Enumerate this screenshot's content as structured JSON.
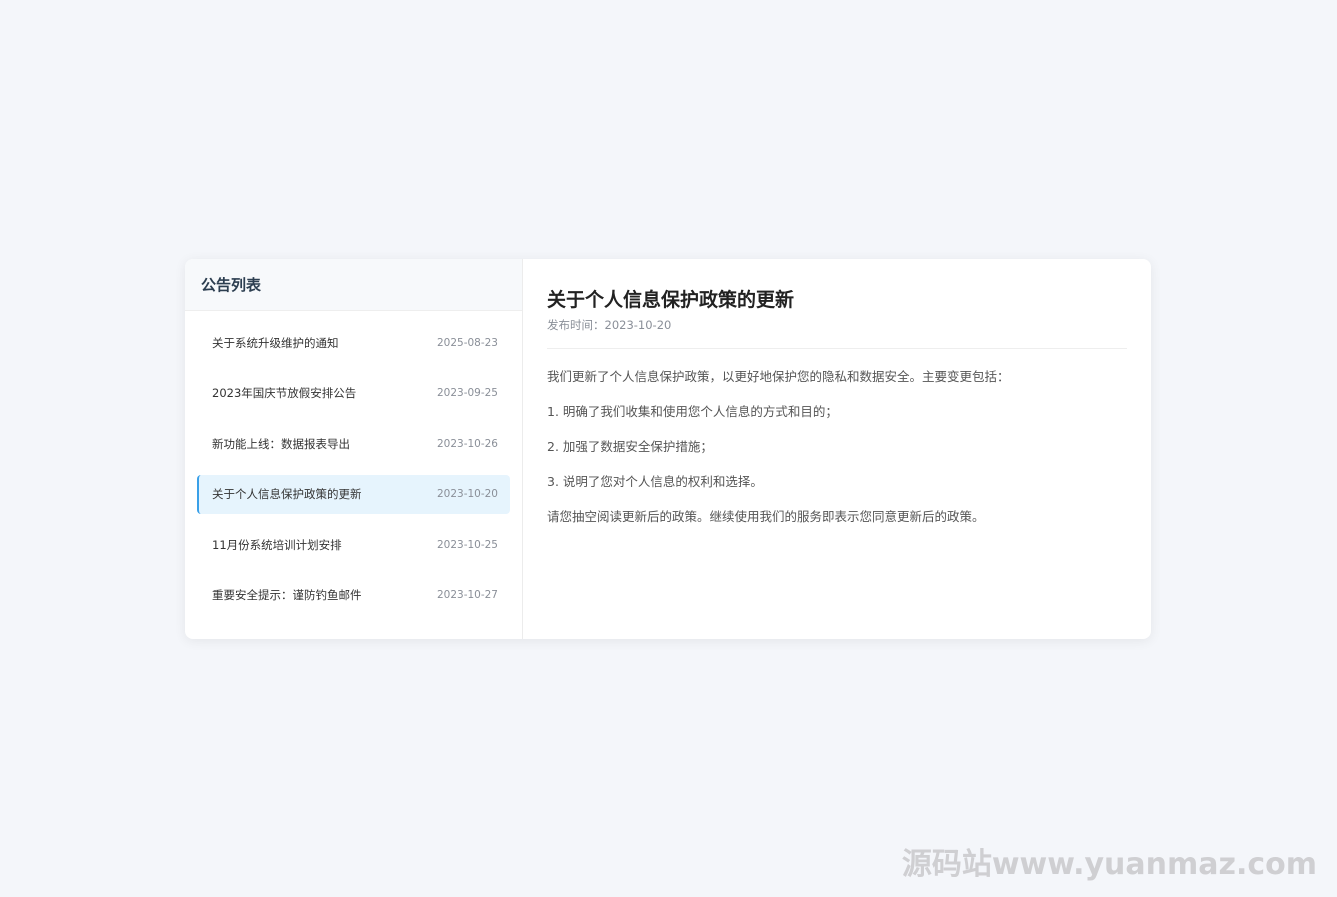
{
  "sidebar": {
    "title": "公告列表",
    "items": [
      {
        "title": "关于系统升级维护的通知",
        "date": "2025-08-23",
        "active": false
      },
      {
        "title": "2023年国庆节放假安排公告",
        "date": "2023-09-25",
        "active": false
      },
      {
        "title": "新功能上线：数据报表导出",
        "date": "2023-10-26",
        "active": false
      },
      {
        "title": "关于个人信息保护政策的更新",
        "date": "2023-10-20",
        "active": true
      },
      {
        "title": "11月份系统培训计划安排",
        "date": "2023-10-25",
        "active": false
      },
      {
        "title": "重要安全提示：谨防钓鱼邮件",
        "date": "2023-10-27",
        "active": false
      }
    ]
  },
  "detail": {
    "title": "关于个人信息保护政策的更新",
    "meta_label": "发布时间：",
    "meta_date": "2023-10-20",
    "paragraphs": [
      "我们更新了个人信息保护政策，以更好地保护您的隐私和数据安全。主要变更包括：",
      "1. 明确了我们收集和使用您个人信息的方式和目的；",
      "2. 加强了数据安全保护措施；",
      "3. 说明了您对个人信息的权利和选择。",
      "请您抽空阅读更新后的政策。继续使用我们的服务即表示您同意更新后的政策。"
    ]
  },
  "watermark": "源码站www.yuanmaz.com",
  "colors": {
    "accent": "#3aa0e8",
    "active_bg": "#e6f4fd",
    "page_bg": "#f4f6fa"
  }
}
